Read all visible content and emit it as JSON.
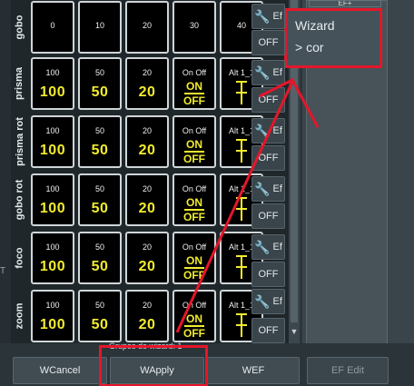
{
  "grid": {
    "rows": [
      {
        "label": "gobo",
        "cells": [
          {
            "type": "value",
            "small": "0",
            "big": ""
          },
          {
            "type": "value",
            "small": "10",
            "big": ""
          },
          {
            "type": "value",
            "small": "20",
            "big": ""
          },
          {
            "type": "value",
            "small": "30",
            "big": ""
          },
          {
            "type": "value",
            "small": "40",
            "big": ""
          }
        ]
      },
      {
        "label": "prisma",
        "cells": [
          {
            "type": "value",
            "small": "100",
            "big": "100"
          },
          {
            "type": "value",
            "small": "50",
            "big": "50"
          },
          {
            "type": "value",
            "small": "20",
            "big": "20"
          },
          {
            "type": "onoff",
            "small": "On Off",
            "on": "ON",
            "off": "OFF"
          },
          {
            "type": "alt",
            "small": "Alt 1_1"
          }
        ]
      },
      {
        "label": "prisma rot",
        "cells": [
          {
            "type": "value",
            "small": "100",
            "big": "100"
          },
          {
            "type": "value",
            "small": "50",
            "big": "50"
          },
          {
            "type": "value",
            "small": "20",
            "big": "20"
          },
          {
            "type": "onoff",
            "small": "On Off",
            "on": "ON",
            "off": "OFF"
          },
          {
            "type": "alt",
            "small": "Alt 1_1"
          }
        ]
      },
      {
        "label": "gobo rot",
        "cells": [
          {
            "type": "value",
            "small": "100",
            "big": "100"
          },
          {
            "type": "value",
            "small": "50",
            "big": "50"
          },
          {
            "type": "value",
            "small": "20",
            "big": "20"
          },
          {
            "type": "onoff",
            "small": "On Off",
            "on": "ON",
            "off": "OFF"
          },
          {
            "type": "alt",
            "small": "Alt 1_1"
          }
        ]
      },
      {
        "label": "foco",
        "cells": [
          {
            "type": "value",
            "small": "100",
            "big": "100"
          },
          {
            "type": "value",
            "small": "50",
            "big": "50"
          },
          {
            "type": "value",
            "small": "20",
            "big": "20"
          },
          {
            "type": "onoff",
            "small": "On Off",
            "on": "ON",
            "off": "OFF"
          },
          {
            "type": "alt",
            "small": "Alt 1_1"
          }
        ]
      },
      {
        "label": "zoom",
        "cells": [
          {
            "type": "value",
            "small": "100",
            "big": "100"
          },
          {
            "type": "value",
            "small": "50",
            "big": "50"
          },
          {
            "type": "value",
            "small": "20",
            "big": "20"
          },
          {
            "type": "onoff",
            "small": "On Off",
            "on": "ON",
            "off": "OFF"
          },
          {
            "type": "alt",
            "small": "Alt 1_1"
          }
        ]
      }
    ]
  },
  "side_buttons": {
    "ef_label": "Ef",
    "off_label": "OFF"
  },
  "right_panel": {
    "ef_plus": "EF+",
    "wizard_title": "Wizard",
    "wizard_sub": "> cor"
  },
  "left_marker": "T",
  "bottom": {
    "grupos_label": "Grupos de wizard: 1",
    "wcancel": "WCancel",
    "wapply": "WApply",
    "wef": "WEF",
    "ef_edit": "EF Edit"
  },
  "colors": {
    "accent_yellow": "#f2ec2e",
    "annotation_red": "#e5162a"
  }
}
